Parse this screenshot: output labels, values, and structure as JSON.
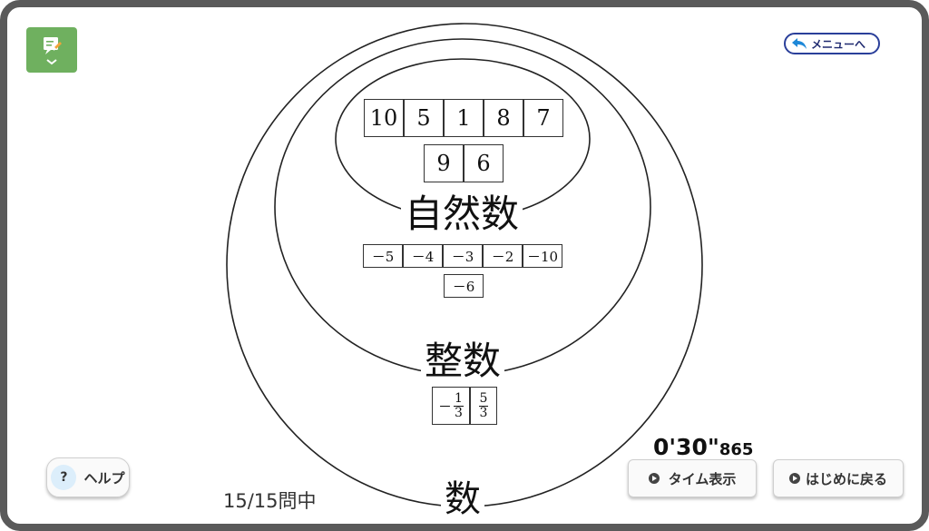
{
  "toolbar": {
    "memo_icon": "memo-pencil-icon",
    "menu_label": "メニューへ"
  },
  "sets": {
    "natural_label": "自然数",
    "integer_label": "整数",
    "number_label": "数"
  },
  "natural_numbers": {
    "row1": [
      "10",
      "5",
      "1",
      "8",
      "7"
    ],
    "row2": [
      "9",
      "6"
    ]
  },
  "integers": {
    "row1": [
      "－5",
      "－4",
      "－3",
      "－2",
      "－10"
    ],
    "row2": [
      "－6"
    ]
  },
  "fractions": [
    {
      "sign": "－",
      "numerator": "1",
      "denominator": "3"
    },
    {
      "sign": "",
      "numerator": "5",
      "denominator": "3"
    }
  ],
  "timer": {
    "main": "0'30\"",
    "ms": "865"
  },
  "buttons": {
    "help": "ヘルプ",
    "help_icon": "?",
    "time_display": "タイム表示",
    "restart": "はじめに戻る"
  },
  "progress": "15/15問中",
  "colors": {
    "frame": "#5a5a5a",
    "memo": "#6fb05f",
    "menu_border": "#2a3f9a"
  }
}
